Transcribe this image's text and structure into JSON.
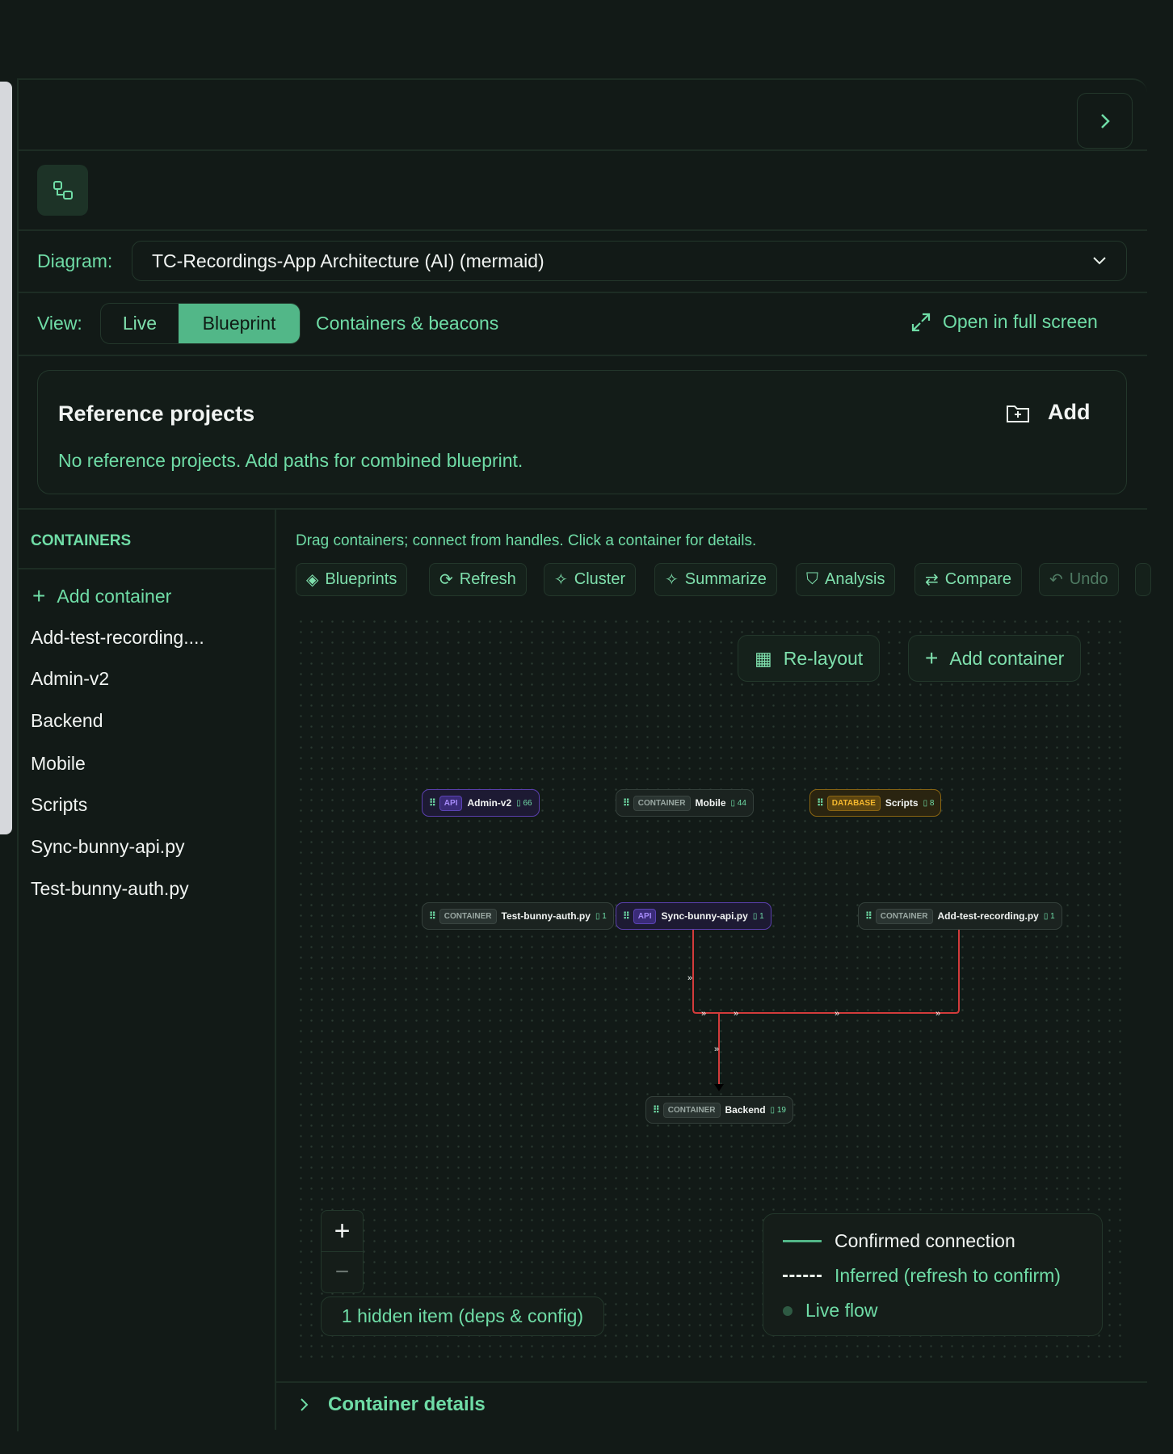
{
  "header": {
    "close_icon": "chevron-right-icon",
    "app_icon": "diagram-icon"
  },
  "diagram": {
    "label": "Diagram:",
    "selected": "TC-Recordings-App Architecture (AI) (mermaid)"
  },
  "view": {
    "label": "View:",
    "options": [
      "Live",
      "Blueprint"
    ],
    "active": "Blueprint",
    "containers_link": "Containers & beacons",
    "fullscreen": "Open in full screen"
  },
  "reference": {
    "title": "Reference projects",
    "add": "Add",
    "empty": "No reference projects. Add paths for combined blueprint."
  },
  "sidebar": {
    "title": "CONTAINERS",
    "add": "Add container",
    "items": [
      "Add-test-recording....",
      "Admin-v2",
      "Backend",
      "Mobile",
      "Scripts",
      "Sync-bunny-api.py",
      "Test-bunny-auth.py"
    ]
  },
  "main": {
    "hint": "Drag containers; connect from handles. Click a container for details.",
    "toolbar": [
      "Blueprints",
      "Refresh",
      "Cluster",
      "Summarize",
      "Analysis",
      "Compare",
      "Undo"
    ],
    "relayout": "Re-layout",
    "add_container": "Add container",
    "nodes": [
      {
        "type": "API",
        "name": "Admin-v2",
        "count": "66"
      },
      {
        "type": "CONTAINER",
        "name": "Mobile",
        "count": "44"
      },
      {
        "type": "DATABASE",
        "name": "Scripts",
        "count": "8"
      },
      {
        "type": "CONTAINER",
        "name": "Test-bunny-auth.py",
        "count": "1"
      },
      {
        "type": "API",
        "name": "Sync-bunny-api.py",
        "count": "1"
      },
      {
        "type": "CONTAINER",
        "name": "Add-test-recording.py",
        "count": "1"
      },
      {
        "type": "CONTAINER",
        "name": "Backend",
        "count": "19"
      }
    ],
    "edges": [
      [
        "Sync-bunny-api.py",
        "Backend"
      ],
      [
        "Add-test-recording.py",
        "Backend"
      ]
    ],
    "edge_color": "#d23b3b",
    "hidden": "1 hidden item (deps & config)",
    "legend": {
      "confirmed": "Confirmed connection",
      "inferred": "Inferred (refresh to confirm)",
      "live": "Live flow"
    }
  },
  "details": {
    "label": "Container details"
  },
  "colors": {
    "accent": "#52b788",
    "text_green": "#6fdca6",
    "api": "#a78bfa",
    "database": "#f5b82e"
  }
}
